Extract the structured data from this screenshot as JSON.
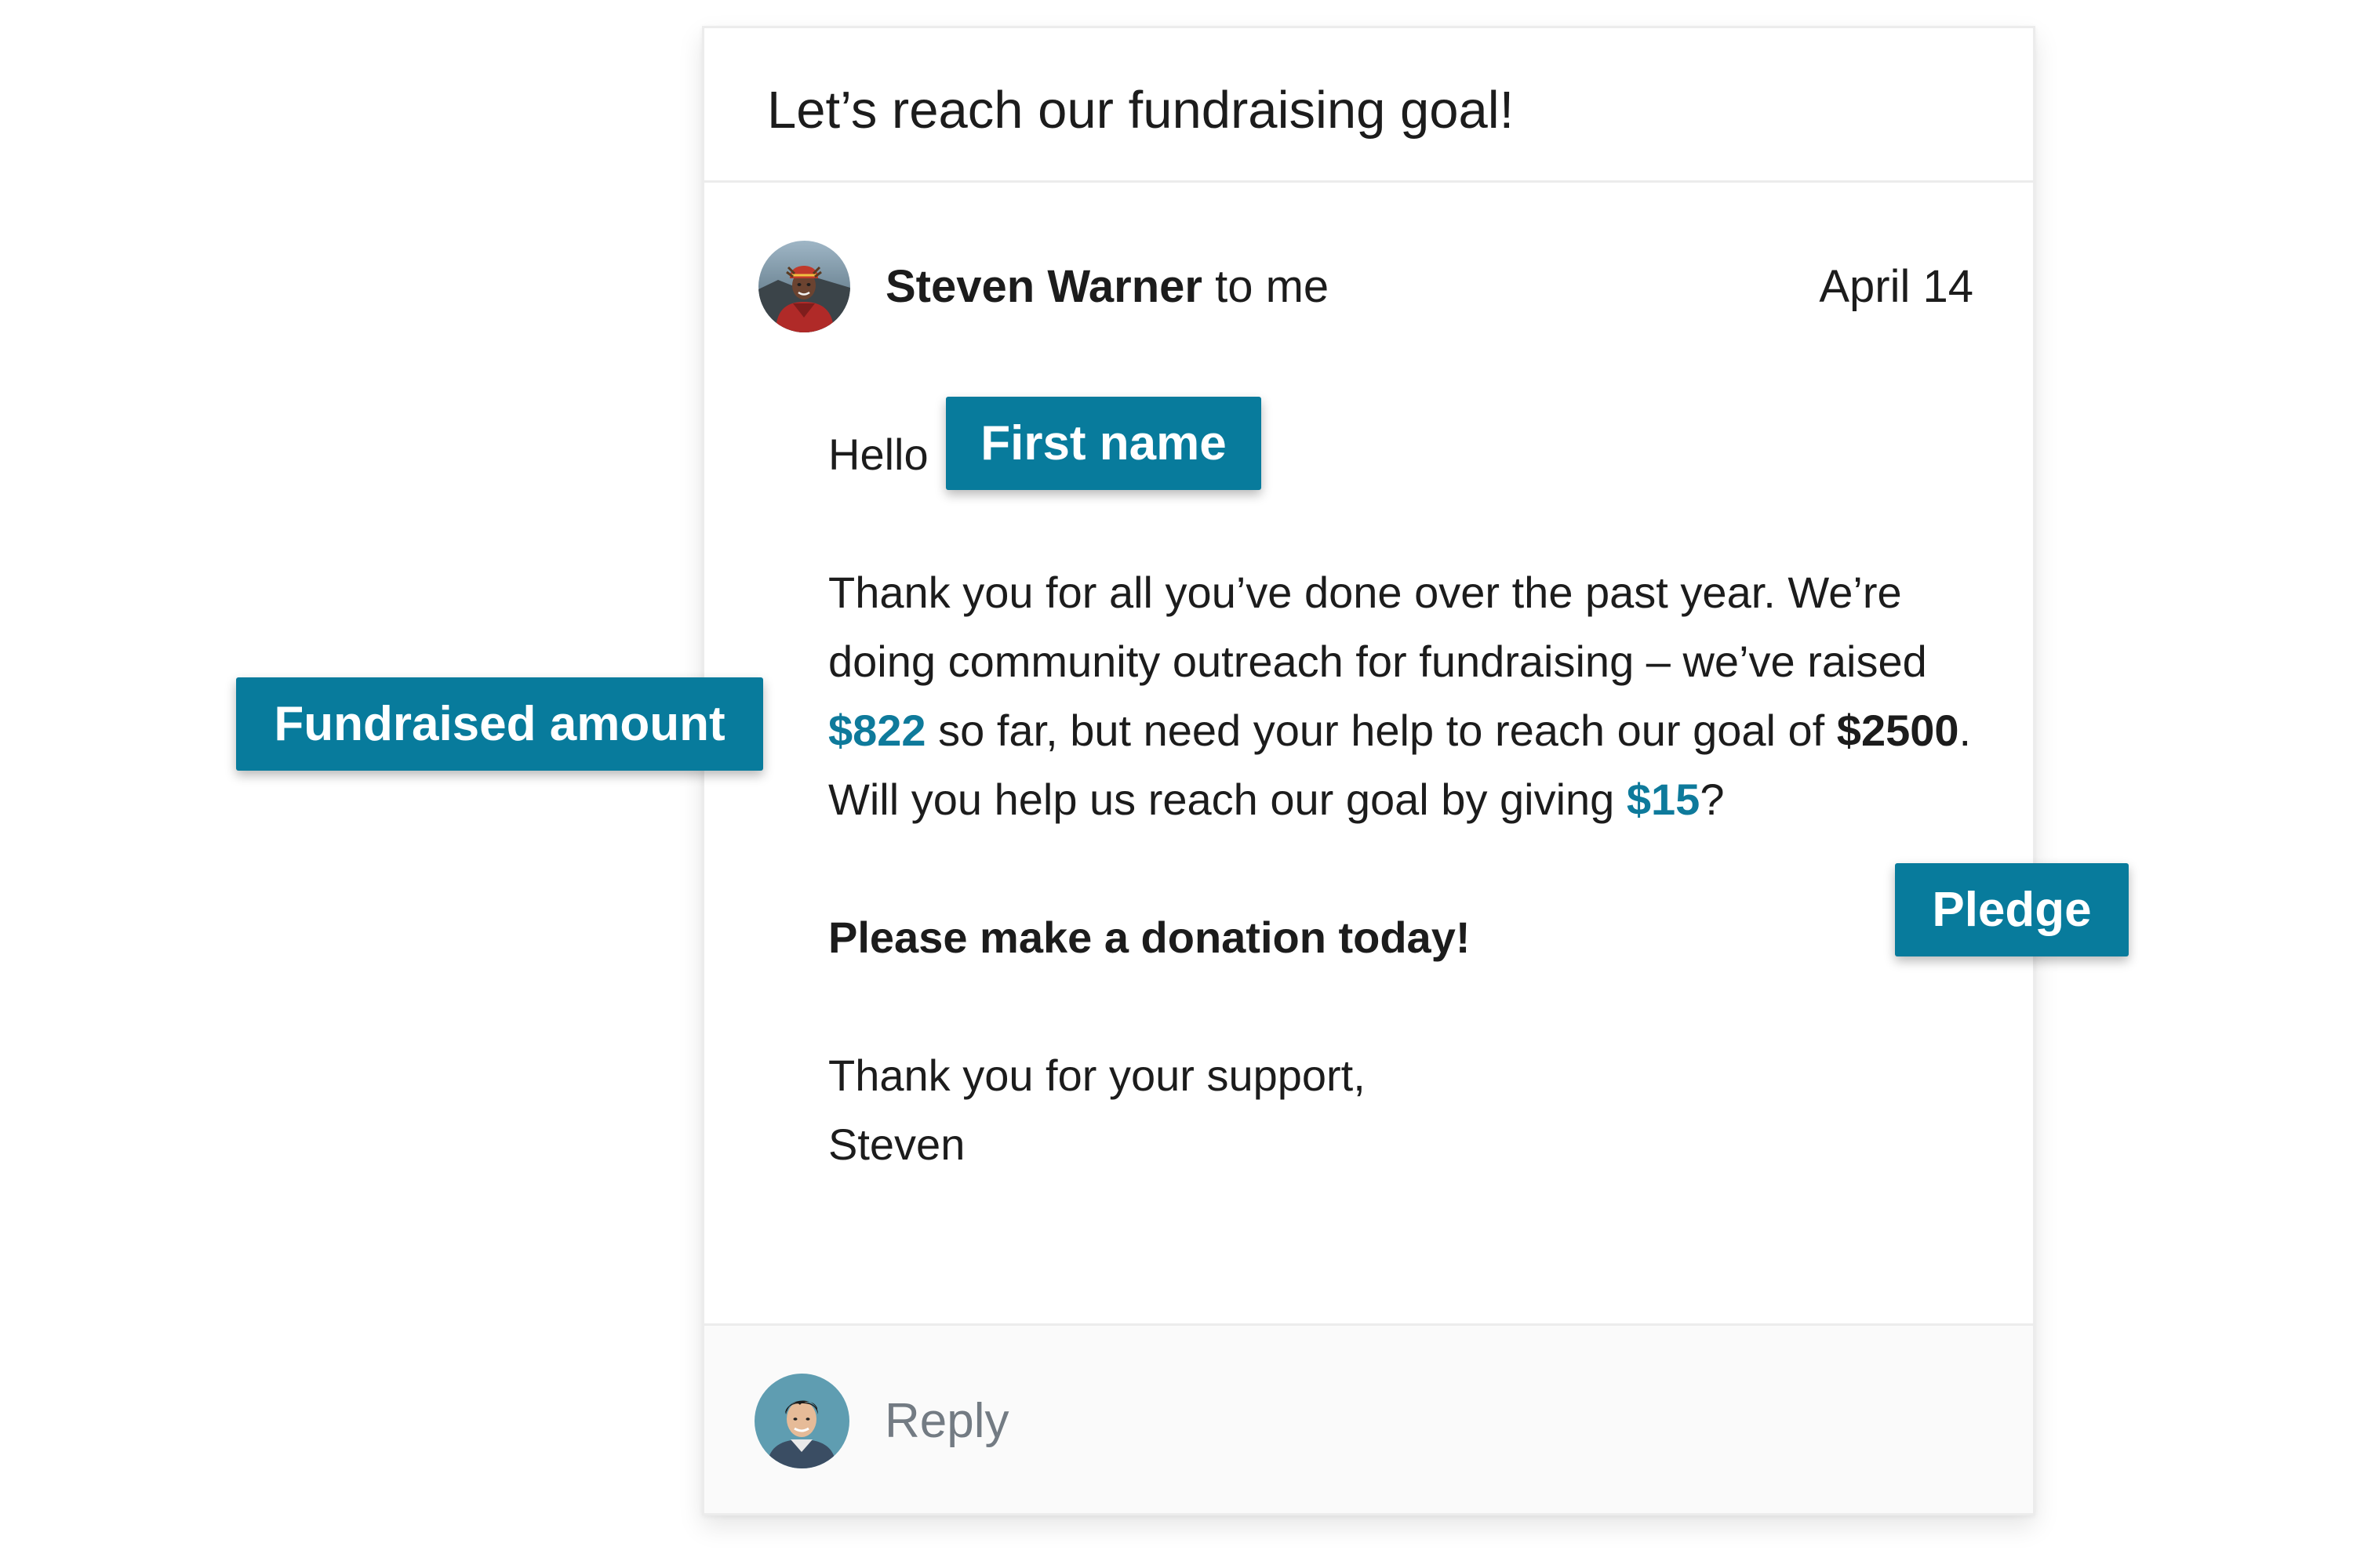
{
  "email": {
    "subject": "Let’s reach our fundraising goal!",
    "sender": {
      "name": "Steven Warner",
      "recipient_text": " to me",
      "date": "April 14"
    },
    "body": {
      "greeting": "Hello ",
      "p1_a": "Thank you for all you’ve done over the past year. We’re doing community outreach for fundraising – we’ve raised ",
      "raised_amount": "$822",
      "p1_b": " so far, but need your help to reach our goal of ",
      "goal_amount": "$2500",
      "p1_c": ". Will you help us reach our goal by giving ",
      "pledge_amount": "$15",
      "p1_d": "?",
      "call_to_action": "Please make a donation today!",
      "signoff": "Thank you for your support,",
      "signature": "Steven"
    },
    "reply": {
      "placeholder": "Reply"
    }
  },
  "tags": {
    "first_name": "First name",
    "fundraised_amount": "Fundraised amount",
    "pledge": "Pledge"
  },
  "colors": {
    "tag_background": "#087b9c",
    "highlight_text": "#0e7a9b",
    "reply_text": "#737b83",
    "border": "#ececec"
  },
  "icons": {
    "sender_avatar": "avatar-photo-man-red-jacket",
    "reply_avatar": "avatar-photo-man-smiling"
  }
}
